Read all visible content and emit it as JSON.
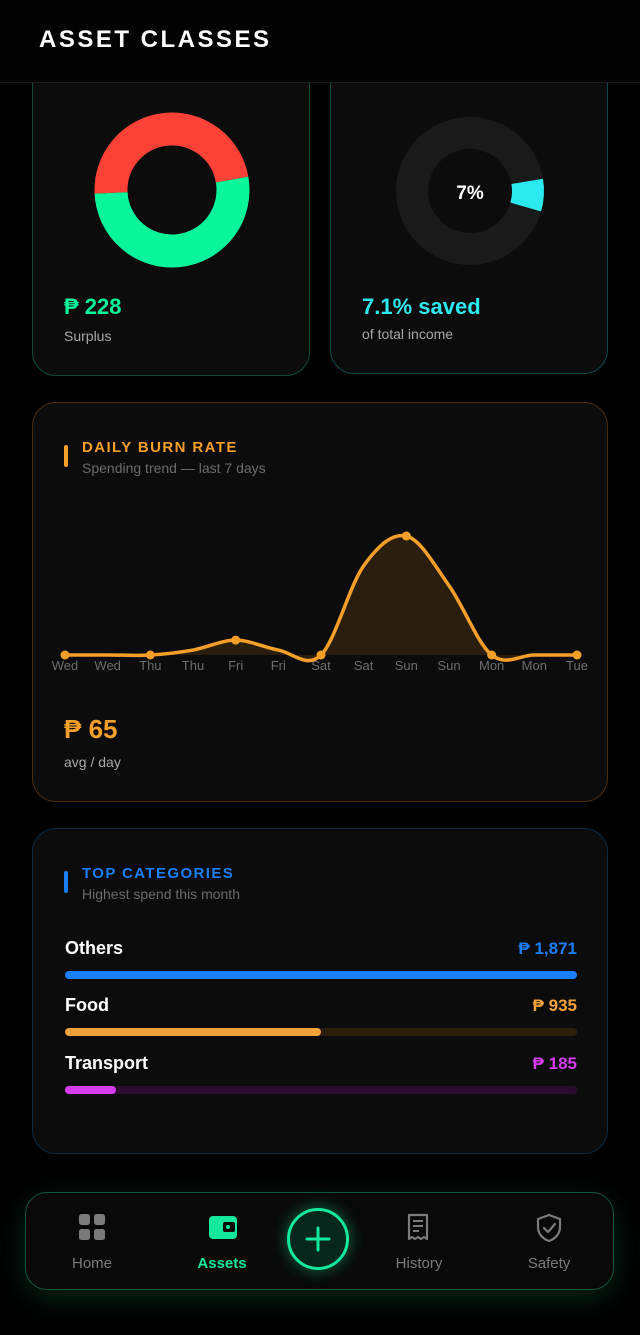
{
  "header": {
    "title": "ASSET CLASSES"
  },
  "surplus": {
    "value": "₱ 228",
    "label": "Surplus"
  },
  "savings": {
    "percent_label": "7%",
    "value": "7.1% saved",
    "label": "of total income",
    "percent": 7.1
  },
  "burn": {
    "title": "DAILY BURN RATE",
    "subtitle": "Spending trend — last 7 days",
    "avg_value": "₱ 65",
    "avg_label": "avg / day"
  },
  "categories": {
    "title": "TOP CATEGORIES",
    "subtitle": "Highest spend this month",
    "items": [
      {
        "name": "Others",
        "amount": "₱ 1,871",
        "fraction": 1.0,
        "color": "#1a7ff5"
      },
      {
        "name": "Food",
        "amount": "₱ 935",
        "fraction": 0.5,
        "color": "#f3a33c"
      },
      {
        "name": "Transport",
        "amount": "₱ 185",
        "fraction": 0.1,
        "color": "#d63df0"
      }
    ]
  },
  "nav": {
    "home": "Home",
    "assets": "Assets",
    "history": "History",
    "safety": "Safety"
  },
  "colors": {
    "green": "#08f59b",
    "red": "#fc4136",
    "cyan": "#2ce9ef",
    "orange": "#f49f2a",
    "blue": "#1a7ff5",
    "magenta": "#d63df0"
  },
  "chart_data": [
    {
      "type": "pie",
      "title": "",
      "labels": [
        "",
        ""
      ],
      "values": [
        52,
        48
      ],
      "colors": [
        "#08f59b",
        "#fc4136"
      ]
    },
    {
      "type": "pie",
      "title": "",
      "labels": [
        "saved",
        ""
      ],
      "values": [
        7.1,
        92.9
      ],
      "colors": [
        "#2ce9ef",
        "#1a1a1a"
      ]
    },
    {
      "type": "area",
      "title": "DAILY BURN RATE",
      "categories": [
        "Wed",
        "Wed",
        "Thu",
        "Thu",
        "Fri",
        "Fri",
        "Sat",
        "Sat",
        "Sun",
        "Sun",
        "Mon",
        "Mon",
        "Tue"
      ],
      "values": [
        0,
        0,
        0,
        5,
        15,
        5,
        0,
        90,
        120,
        70,
        0,
        0,
        0
      ],
      "ylim": [
        0,
        120
      ],
      "grid": false
    }
  ]
}
